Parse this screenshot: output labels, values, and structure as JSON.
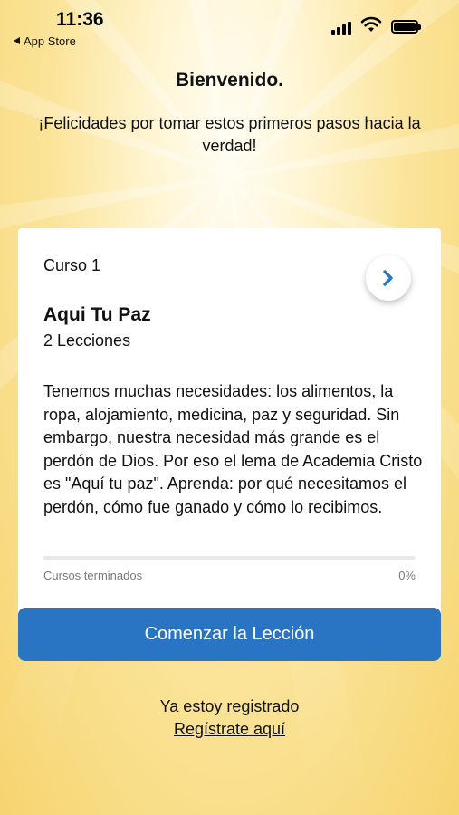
{
  "status_bar": {
    "time": "11:36",
    "back_label": "App Store"
  },
  "header": {
    "title": "Bienvenido.",
    "subtitle": "¡Felicidades por tomar estos primeros pasos hacia la verdad!"
  },
  "course_card": {
    "course_number": "Curso 1",
    "title": "Aqui Tu Paz",
    "lessons": "2 Lecciones",
    "description": "Tenemos muchas necesidades: los alimentos, la ropa, alojamiento, medicina, paz y seguridad. Sin embargo, nuestra necesidad más grande es el perdón de Dios. Por eso el lema de Academia Cristo es \"Aquí tu paz\". Aprenda: por qué necesitamos el perdón, cómo fue ganado y cómo lo recibimos.",
    "progress_label": "Cursos terminados",
    "progress_percent": "0%",
    "progress_value": 0,
    "next_icon": "chevron-right-icon"
  },
  "actions": {
    "start_label": "Comenzar la Lección",
    "registered_text": "Ya estoy registrado",
    "register_link": "Regístrate aquí"
  },
  "colors": {
    "accent": "#2a74c4",
    "background": "#f7d77a",
    "card": "#ffffff"
  }
}
